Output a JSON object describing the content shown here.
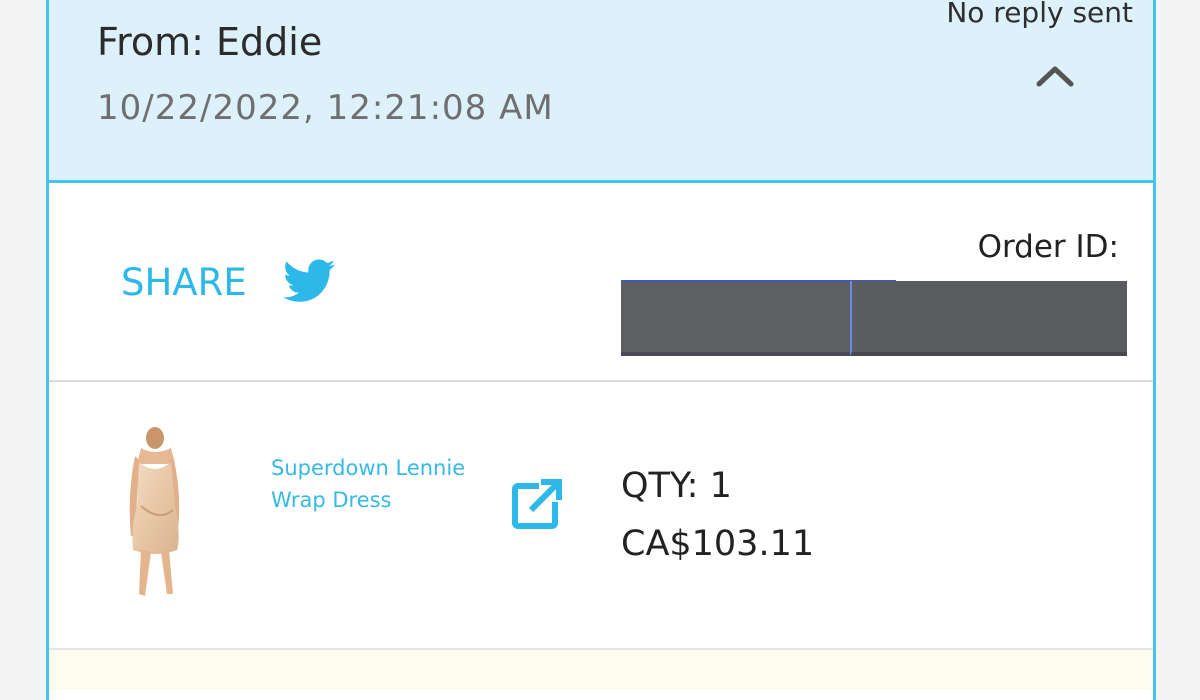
{
  "message": {
    "from_text": "From: Eddie",
    "timestamp": "10/22/2022, 12:21:08 AM",
    "reply_status": "No reply sent",
    "collapse_icon": "chevron-up-icon"
  },
  "share": {
    "label": "SHARE",
    "icon": "twitter-icon"
  },
  "order": {
    "label": "Order ID:",
    "value_redacted": true
  },
  "item": {
    "name": "Superdown Lennie Wrap Dress",
    "link_icon": "external-link-icon",
    "qty_text": "QTY: 1",
    "price_text": "CA$103.11"
  },
  "colors": {
    "accent": "#2cb8e8",
    "header_bg": "#dcf1fa",
    "border": "#43c4e8",
    "redaction": "#5e5f62"
  }
}
